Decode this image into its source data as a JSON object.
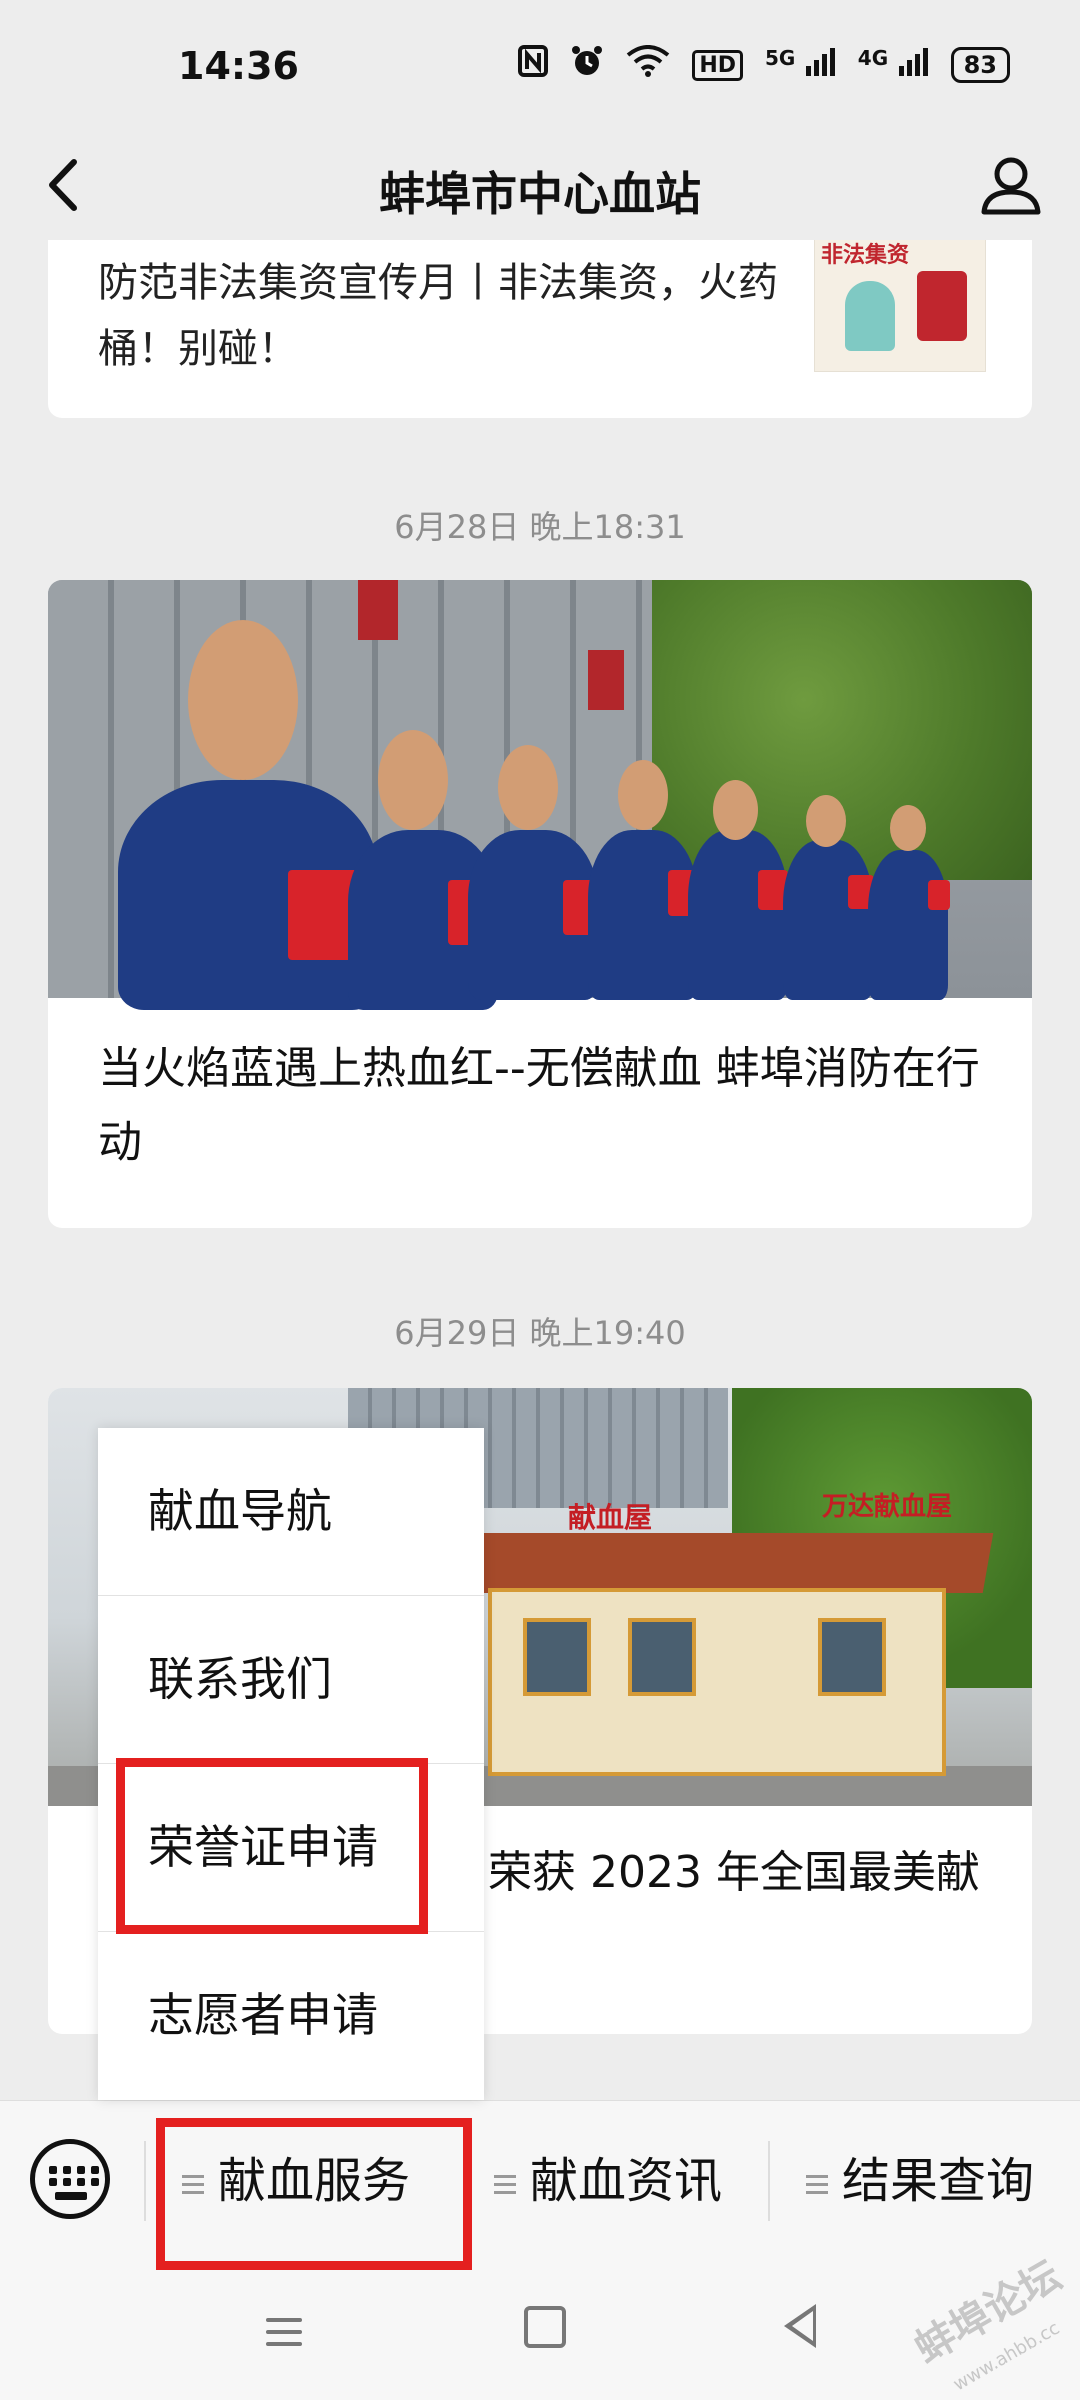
{
  "status_bar": {
    "time": "14:36",
    "icons": [
      "nfc-icon",
      "alarm-icon",
      "wifi-icon",
      "hd-icon",
      "signal-5g-icon",
      "signal-4g-icon"
    ],
    "network_5g": "5G",
    "network_4g": "4G",
    "hd": "HD",
    "battery": "83"
  },
  "header": {
    "title": "蚌埠市中心血站",
    "back_icon": "chevron-left-icon",
    "profile_icon": "person-icon"
  },
  "articles": [
    {
      "caption": "防范非法集资宣传月丨非法集资，火药桶！别碰！",
      "thumb_label": "非法集资"
    },
    {
      "timestamp": "6月28日 晚上18:31",
      "caption": "当火焰蓝遇上热血红--无偿献血 蚌埠消防在行动"
    },
    {
      "timestamp": "6月29日 晚上19:40",
      "caption": "荣获 2023 年全国最美献",
      "sign_left": "献血屋",
      "sign_right": "万达献血屋"
    }
  ],
  "popup_menu": {
    "items": [
      {
        "label": "献血导航"
      },
      {
        "label": "联系我们"
      },
      {
        "label": "荣誉证申请",
        "highlighted": true
      },
      {
        "label": "志愿者申请"
      }
    ]
  },
  "menu_bar": {
    "keyboard_icon": "keyboard-icon",
    "tabs": [
      {
        "label": "献血服务",
        "highlighted": true
      },
      {
        "label": "献血资讯"
      },
      {
        "label": "结果查询"
      }
    ]
  },
  "watermark": {
    "text": "蚌埠论坛",
    "url": "www.ahbb.cc"
  },
  "colors": {
    "highlight": "#e4201f",
    "background": "#ededed"
  }
}
